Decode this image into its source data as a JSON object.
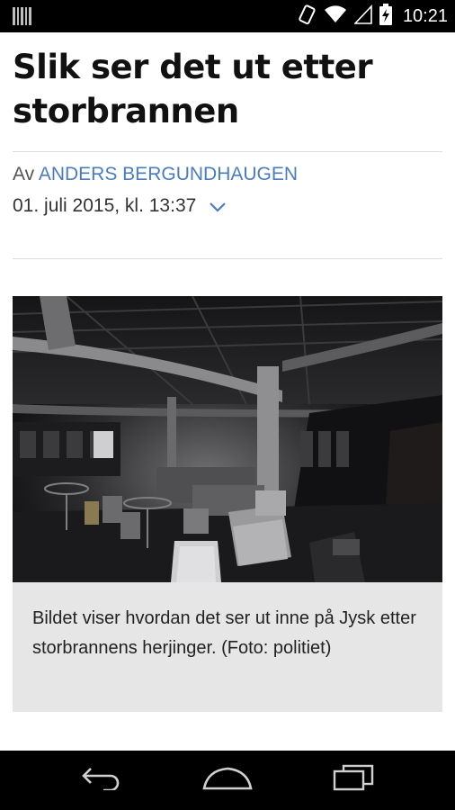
{
  "status_bar": {
    "time": "10:21"
  },
  "article": {
    "title": "Slik ser det ut etter storbrannen",
    "byline_prefix": "Av",
    "author": "ANDERS BERGUNDHAUGEN",
    "date": "01. juli 2015, kl. 13:37",
    "image_caption": "Bildet viser hvordan det ser ut inne på Jysk etter storbrannens herjinger. (Foto: politiet)"
  },
  "icons": {
    "status": [
      "barcode-notification-icon",
      "vibrate-icon",
      "wifi-icon",
      "signal-icon",
      "battery-charging-icon"
    ],
    "date_toggle": "chevron-down-icon",
    "nav": [
      "back-icon",
      "home-icon",
      "recents-icon"
    ]
  },
  "colors": {
    "author_link": "#4a7cc0",
    "caption_background": "#e6e6e6",
    "system_bars": "#000000"
  }
}
